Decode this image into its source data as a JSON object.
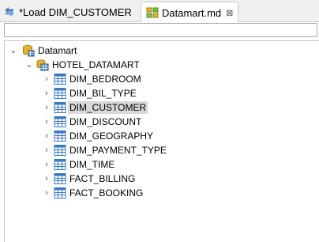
{
  "tabs": [
    {
      "label": "*Load DIM_CUSTOMER",
      "icon": "arrows-icon",
      "active": false
    },
    {
      "label": "Datamart.md",
      "icon": "datamart-icon",
      "active": true,
      "close": "⊠"
    }
  ],
  "filter": {
    "value": "",
    "placeholder": ""
  },
  "tree": {
    "root": {
      "label": "Datamart",
      "icon": "database-icon",
      "expanded": true
    },
    "schema": {
      "label": "HOTEL_DATAMART",
      "icon": "schema-icon",
      "expanded": true
    },
    "tables": [
      {
        "label": "DIM_BEDROOM"
      },
      {
        "label": "DIM_BIL_TYPE"
      },
      {
        "label": "DIM_CUSTOMER",
        "selected": true
      },
      {
        "label": "DIM_DISCOUNT"
      },
      {
        "label": "DIM_GEOGRAPHY"
      },
      {
        "label": "DIM_PAYMENT_TYPE"
      },
      {
        "label": "DIM_TIME"
      },
      {
        "label": "FACT_BILLING"
      },
      {
        "label": "FACT_BOOKING"
      }
    ]
  },
  "colors": {
    "selection": "#d9d9d9",
    "table_icon": "#3a78c3"
  }
}
